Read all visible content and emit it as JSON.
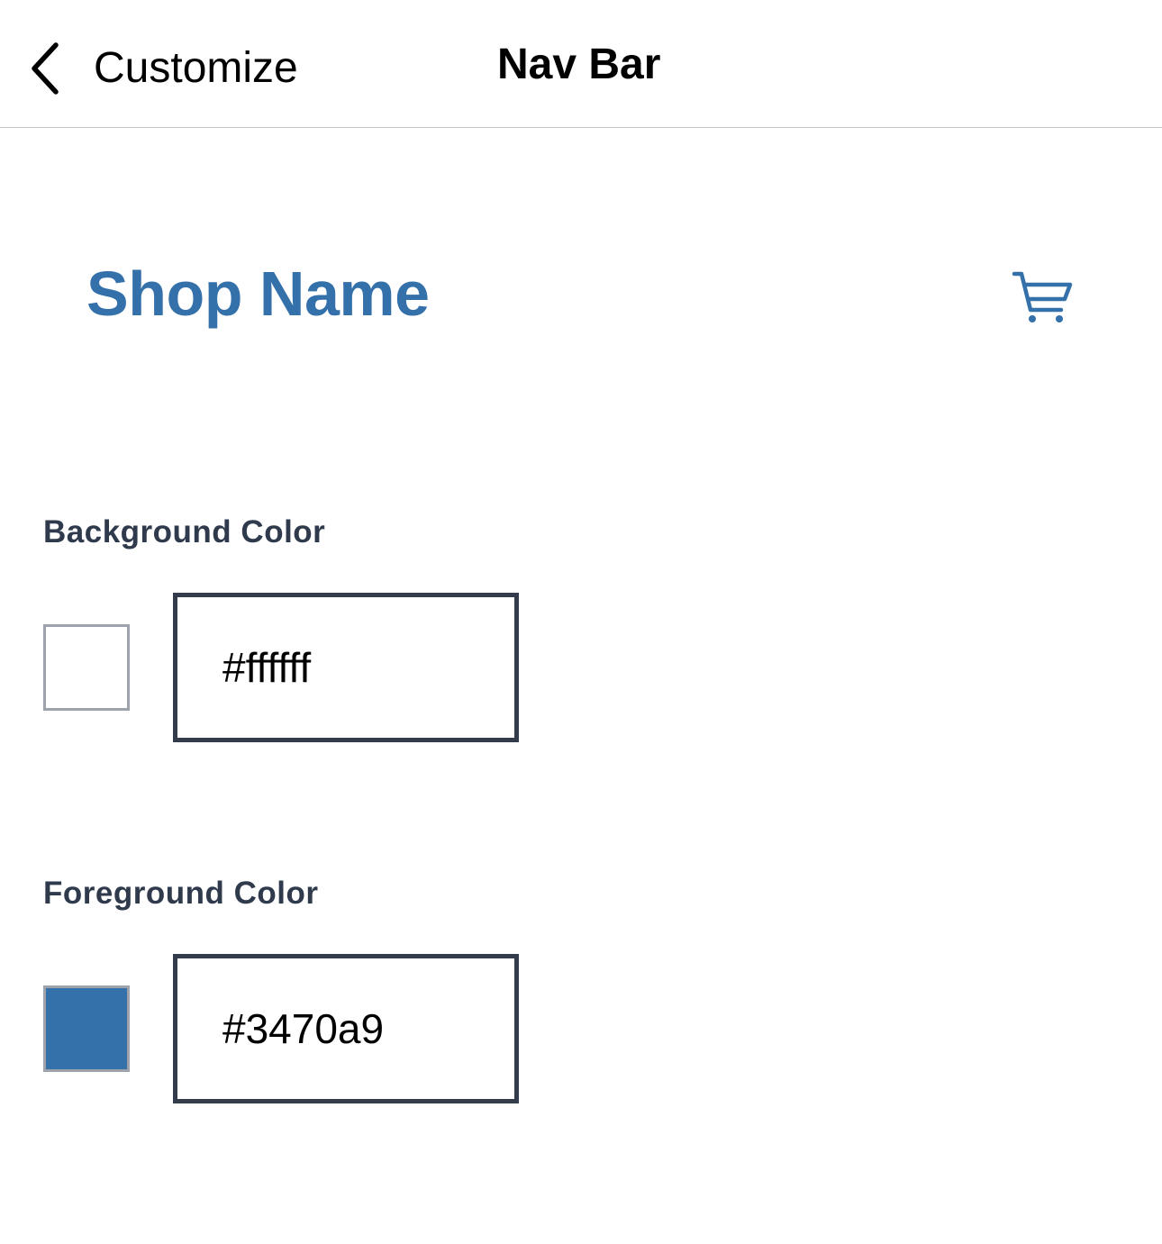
{
  "header": {
    "back_label": "Customize",
    "title": "Nav Bar",
    "back_icon": "chevron-left-icon"
  },
  "preview": {
    "shop_name": "Shop Name",
    "cart_icon": "shopping-cart-icon",
    "foreground_color": "#3470a9",
    "background_color": "#ffffff"
  },
  "background_color": {
    "label": "Background Color",
    "value": "#ffffff",
    "swatch_color": "#ffffff"
  },
  "foreground_color": {
    "label": "Foreground Color",
    "value": "#3470a9",
    "swatch_color": "#3470a9"
  }
}
